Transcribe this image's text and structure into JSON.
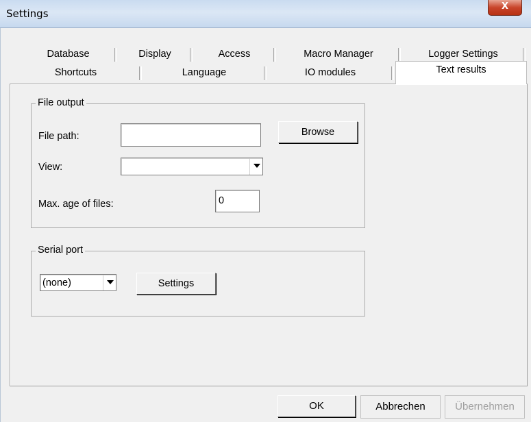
{
  "window": {
    "title": "Settings",
    "close_label": "X"
  },
  "tabs": {
    "row1": [
      "Database",
      "Display",
      "Access",
      "Macro Manager",
      "Logger Settings"
    ],
    "row2": [
      "Shortcuts",
      "Language",
      "IO modules",
      "Text results"
    ],
    "active": "Text results"
  },
  "file_output": {
    "legend": "File output",
    "file_path_label": "File path:",
    "file_path_value": "",
    "browse_label": "Browse",
    "view_label": "View:",
    "view_value": "",
    "max_age_label": "Max. age of files:",
    "max_age_value": "0"
  },
  "serial_port": {
    "legend": "Serial port",
    "port_value": "(none)",
    "settings_label": "Settings"
  },
  "footer": {
    "ok": "OK",
    "cancel": "Abbrechen",
    "apply": "Übernehmen"
  },
  "colors": {
    "close_button": "#c9452b",
    "titlebar": "#dbe7f5",
    "disabled_text": "#a0a0a0"
  },
  "icons": {
    "dropdown": "chevron-down-icon",
    "close": "close-icon"
  }
}
